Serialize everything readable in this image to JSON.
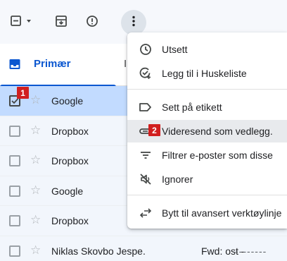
{
  "toolbar": {
    "select_icon": "checkbox-indeterminate-icon",
    "archive_icon": "archive-icon",
    "spam_icon": "report-spam-icon",
    "more_icon": "more-vert-icon"
  },
  "tabs": {
    "primary_label": "Primær",
    "next_label_partial": "I"
  },
  "emails": [
    {
      "sender": "Google",
      "subject": "",
      "selected": true
    },
    {
      "sender": "Dropbox",
      "subject": "",
      "selected": false
    },
    {
      "sender": "Dropbox",
      "subject": "",
      "selected": false
    },
    {
      "sender": "Google",
      "subject": "",
      "selected": false
    },
    {
      "sender": "Dropbox",
      "subject": "",
      "selected": false
    },
    {
      "sender": "Niklas Skovbo Jespe.",
      "subject": "Fwd: ost -",
      "dashes": "--------",
      "selected": false
    }
  ],
  "menu": {
    "items": [
      {
        "label": "Utsett",
        "icon": "clock-icon"
      },
      {
        "label": "Legg til i Huskeliste",
        "icon": "add-task-icon"
      },
      {
        "label": "Sett på etikett",
        "icon": "label-icon"
      },
      {
        "label": "Videresend som vedlegg.",
        "icon": "forward-attachment-icon"
      },
      {
        "label": "Filtrer e-poster som disse",
        "icon": "filter-icon"
      },
      {
        "label": "Ignorer",
        "icon": "mute-icon"
      },
      {
        "label": "Bytt til avansert verktøylinje",
        "icon": "swap-icon"
      }
    ]
  },
  "badges": [
    "1",
    "2"
  ],
  "colors": {
    "selected_row": "#c2dbff",
    "accent": "#0b57d0",
    "badge": "#d11f1f",
    "hover": "#e8eaed"
  }
}
